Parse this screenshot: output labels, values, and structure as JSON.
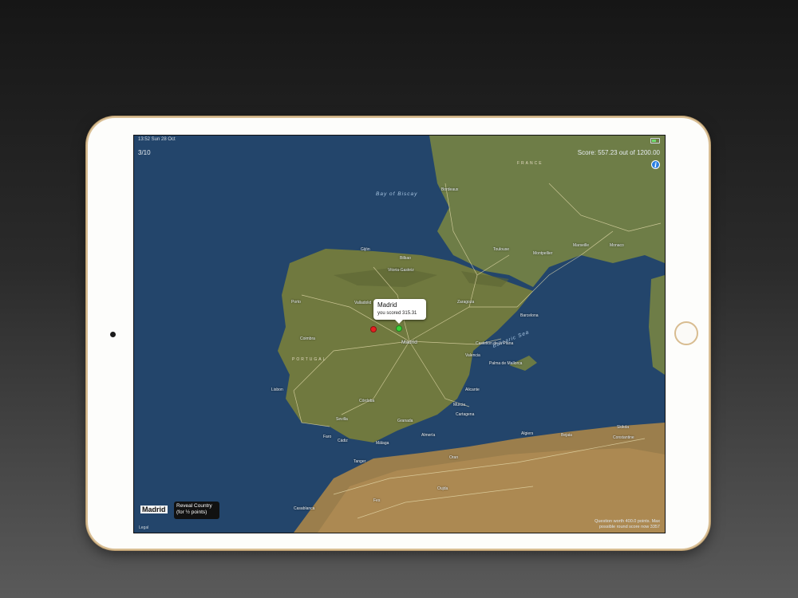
{
  "status_bar": {
    "time": "13:52  Sun 28 Oct"
  },
  "game": {
    "round": "3/10",
    "score": "Score: 557.23 out of 1200.00",
    "answer": "Madrid",
    "reveal_button": [
      "Reveal Country",
      "(for ½ points)"
    ],
    "bottom_note": [
      "Question worth 400.0 points. Max",
      "possible round score now 3357"
    ]
  },
  "callout": {
    "title": "Madrid",
    "subtitle": "you scored 315.31"
  },
  "map": {
    "legal": "Legal",
    "water_labels": [
      "Bay of Biscay",
      "Balearic Sea"
    ],
    "country_labels": [
      "FRANCE",
      "PORTUGAL"
    ],
    "cities": [
      "Gijón",
      "Bilbao",
      "Vitoria-Gasteiz",
      "Zaragoza",
      "Valladolid",
      "Madrid",
      "Barcelona",
      "Castellón de la Plana",
      "Valencia",
      "Palma de Mallorca",
      "Alicante",
      "Murcia",
      "Cartagena",
      "Córdoba",
      "Sevilla",
      "Cádiz",
      "Málaga",
      "Granada",
      "Almería",
      "Lisbon",
      "Porto",
      "Coimbra",
      "Faro",
      "Tanger",
      "Oran",
      "Algiers",
      "Constantine",
      "Oujda",
      "Fes",
      "Casablanca",
      "Marseille",
      "Montpellier",
      "Toulouse",
      "Bordeaux",
      "Monaco",
      "Skikda",
      "Bejaia"
    ]
  },
  "colors": {
    "sea": "#23456b",
    "land": "#6b7a45",
    "pin_guess": "#e62020",
    "pin_answer": "#39d339",
    "info": "#2a7fe0"
  }
}
